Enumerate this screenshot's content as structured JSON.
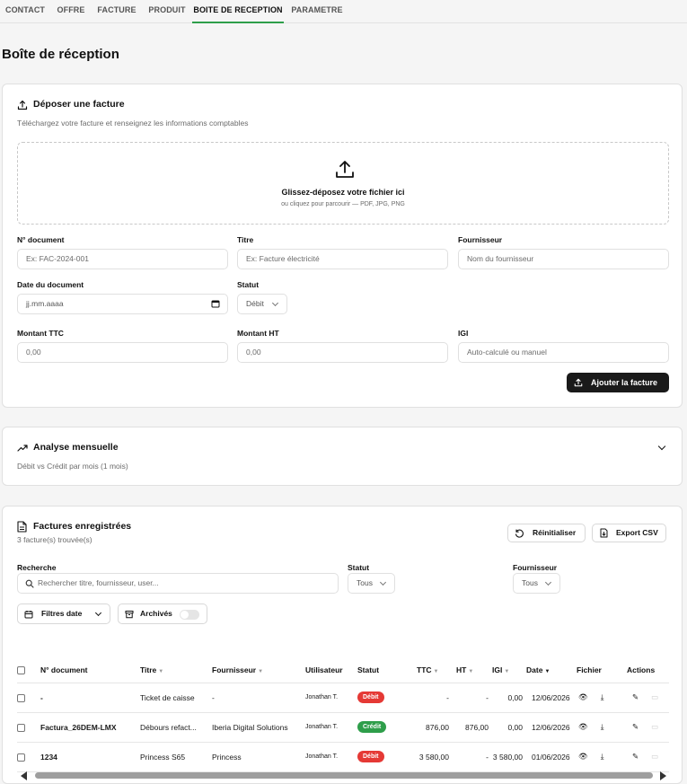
{
  "nav": {
    "tabs": [
      "CONTACT",
      "OFFRE",
      "FACTURE",
      "PRODUIT",
      "BOITE DE RECEPTION",
      "PARAMETRE"
    ],
    "active": "BOITE DE RECEPTION"
  },
  "page_title": "Boîte de réception",
  "upload": {
    "title": "Déposer une facture",
    "subtitle": "Téléchargez votre facture et renseignez les informations comptables",
    "drop_title": "Glissez-déposez votre fichier ici",
    "drop_sub": "ou cliquez pour parcourir — PDF, JPG, PNG",
    "fields": {
      "doc_label": "N° document",
      "doc_placeholder": "Ex: FAC-2024-001",
      "title_label": "Titre",
      "title_placeholder": "Ex: Facture électricité",
      "supplier_label": "Fournisseur",
      "supplier_placeholder": "Nom du fournisseur",
      "date_label": "Date du document",
      "date_placeholder": "jj.mm.aaaa",
      "status_label": "Statut",
      "status_value": "Débit",
      "ttc_label": "Montant TTC",
      "ttc_value": "0,00",
      "ht_label": "Montant HT",
      "ht_value": "0,00",
      "igi_label": "IGI",
      "igi_placeholder": "Auto-calculé ou manuel"
    },
    "submit_label": "Ajouter la facture"
  },
  "analysis": {
    "title": "Analyse mensuelle",
    "subtitle": "Débit vs Crédit par mois (1 mois)"
  },
  "invoices": {
    "title": "Factures enregistrées",
    "count": "3 facture(s) trouvée(s)",
    "reset_label": "Réinitialiser",
    "export_label": "Export CSV",
    "search_label": "Recherche",
    "search_placeholder": "Rechercher titre, fournisseur, user...",
    "status_label": "Statut",
    "status_value": "Tous",
    "supplier_label": "Fournisseur",
    "supplier_value": "Tous",
    "date_filter_label": "Filtres date",
    "archived_label": "Archivés",
    "columns": [
      "N° document",
      "Titre",
      "Fournisseur",
      "Utilisateur",
      "Statut",
      "TTC",
      "HT",
      "IGI",
      "Date",
      "Fichier",
      "Actions"
    ],
    "rows": [
      {
        "doc": "-",
        "titre": "Ticket de caisse",
        "fournisseur": "-",
        "user": "Jonathan T.",
        "statut": "Débit",
        "ttc": "-",
        "ht": "-",
        "igi": "0,00",
        "date": "12/06/2026"
      },
      {
        "doc": "Factura_26DEM-LMX",
        "titre": "Débours refact...",
        "fournisseur": "Iberia Digital Solutions",
        "user": "Jonathan T.",
        "statut": "Crédit",
        "ttc": "876,00",
        "ht": "876,00",
        "igi": "0,00",
        "date": "12/06/2026"
      },
      {
        "doc": "1234",
        "titre": "Princess S65",
        "fournisseur": "Princess",
        "user": "Jonathan T.",
        "statut": "Débit",
        "ttc": "3 580,00",
        "ht": "-",
        "igi": "3 580,00",
        "date": "01/06/2026"
      }
    ]
  },
  "colors": {
    "debit": "#e53935",
    "credit": "#2e9e4a",
    "active_tab": "#2e9e4a",
    "primary_button": "#1a1a1a"
  }
}
